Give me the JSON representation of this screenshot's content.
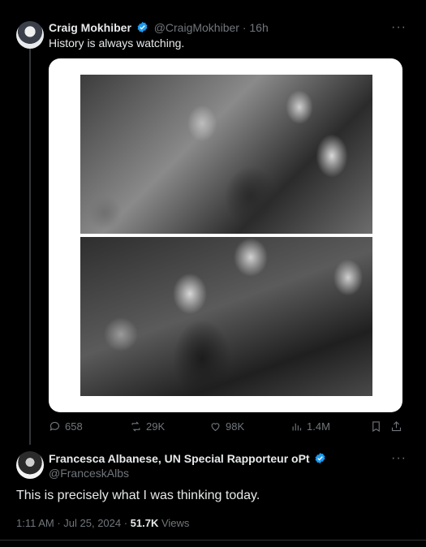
{
  "tweet": {
    "author_name": "Craig Mokhiber",
    "author_handle": "@CraigMokhiber",
    "separator": "·",
    "time": "16h",
    "text": "History is always watching.",
    "more": "···",
    "stats": {
      "replies": "658",
      "reposts": "29K",
      "likes": "98K",
      "views": "1.4M"
    }
  },
  "reply": {
    "author_name": "Francesca Albanese, UN Special Rapporteur oPt",
    "author_handle": "@FranceskAlbs",
    "more": "···",
    "text": "This is precisely what I was thinking today.",
    "timestamp": "1:11 AM · Jul 25, 2024 · ",
    "views_count": "51.7K",
    "views_label": " Views"
  },
  "colors": {
    "verified": "#1d9bf0",
    "secondary_text": "#71767b"
  },
  "icons": [
    "verified-badge-icon",
    "reply-icon",
    "repost-icon",
    "like-icon",
    "views-icon",
    "bookmark-icon",
    "share-icon",
    "more-icon"
  ]
}
